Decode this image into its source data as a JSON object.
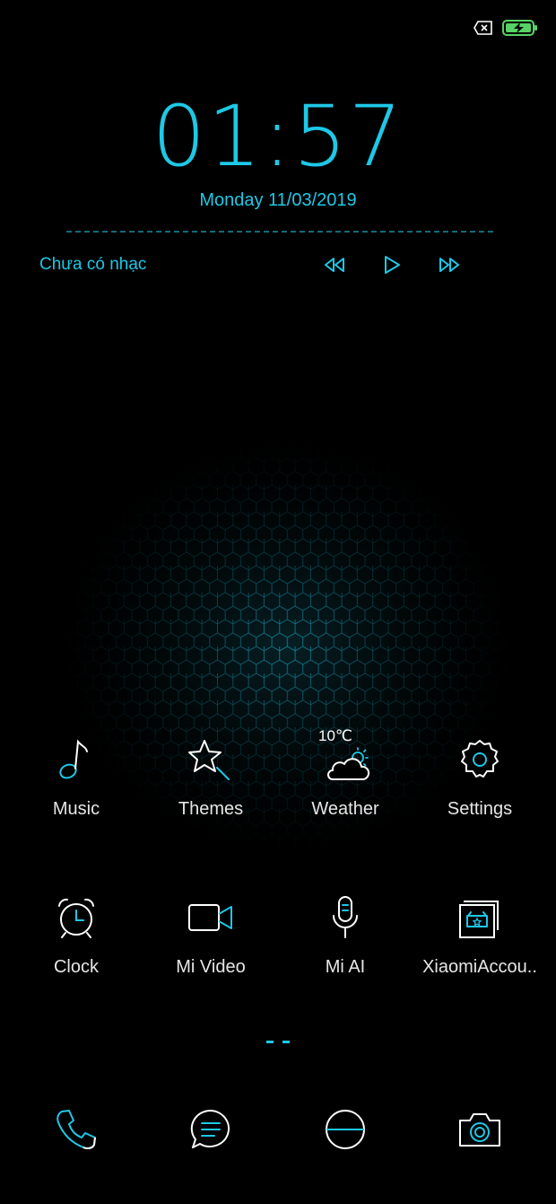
{
  "status_bar": {
    "icons": [
      "no-sim-icon",
      "battery-charging-icon"
    ],
    "battery_color": "#56d364"
  },
  "lockscreen": {
    "time": "01:57",
    "date": "Monday 11/03/2019",
    "music": {
      "status": "Chưa có nhạc",
      "controls": [
        "rewind-icon",
        "play-icon",
        "fast-forward-icon"
      ]
    }
  },
  "apps": {
    "row1": [
      {
        "label": "Music",
        "icon": "music-note-icon"
      },
      {
        "label": "Themes",
        "icon": "star-wand-icon"
      },
      {
        "label": "Weather",
        "icon": "cloud-sun-icon",
        "temp": "10℃"
      },
      {
        "label": "Settings",
        "icon": "gear-icon"
      }
    ],
    "row2": [
      {
        "label": "Clock",
        "icon": "alarm-clock-icon"
      },
      {
        "label": "Mi Video",
        "icon": "video-camera-icon"
      },
      {
        "label": "Mi AI",
        "icon": "microphone-icon"
      },
      {
        "label": "XiaomiAccou..",
        "icon": "xiaomi-account-icon"
      }
    ]
  },
  "page_indicator": {
    "pages": 2,
    "active": 1
  },
  "dock": [
    {
      "icon": "phone-icon"
    },
    {
      "icon": "messages-icon"
    },
    {
      "icon": "browser-icon"
    },
    {
      "icon": "camera-icon"
    }
  ],
  "colors": {
    "accent": "#1ec8e6",
    "background": "#000000",
    "label": "#e6e6e6"
  }
}
